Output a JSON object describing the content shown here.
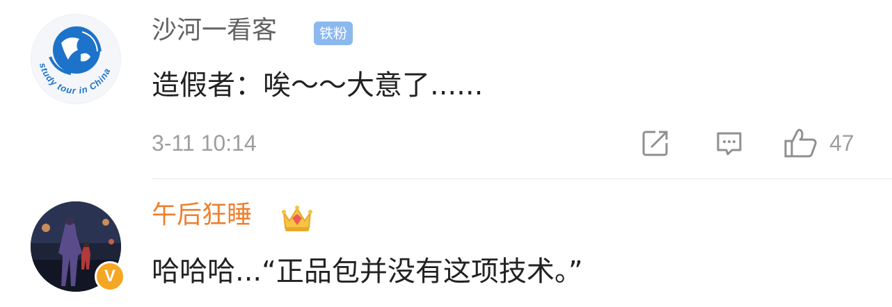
{
  "comments": [
    {
      "username": "沙河一看客",
      "badge": "铁粉",
      "avatar_text": "study tour in China",
      "content": "造假者：唉～～大意了......",
      "timestamp": "3-11 10:14",
      "like_count": "47",
      "colors": {
        "username": "#636363",
        "badge_bg": "#8cb8f0"
      },
      "icons": [
        "share-icon",
        "comment-icon",
        "thumbs-up-icon"
      ]
    },
    {
      "username": "午后狂睡",
      "content": "哈哈哈...“正品包并没有这项技术。”",
      "verified_mark": "V",
      "colors": {
        "username": "#ee7f2d",
        "verified": "#f5a623"
      },
      "icons": [
        "crown-icon",
        "verified-icon"
      ]
    }
  ]
}
